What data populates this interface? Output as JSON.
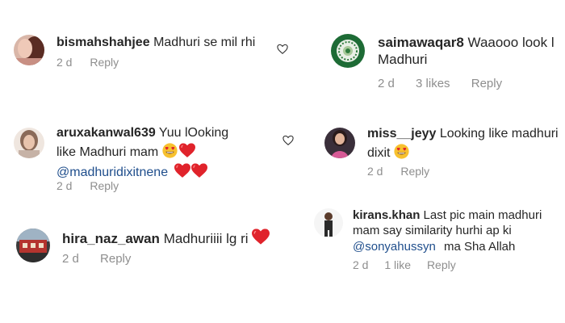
{
  "comments": [
    {
      "username": "bismahshahjee",
      "text": "Madhuri se mil rhi",
      "time": "2 d",
      "reply_label": "Reply"
    },
    {
      "username": "saimawaqar8",
      "text_line1": "Waaooo look l",
      "text_line2": "Madhuri",
      "time": "2 d",
      "likes": "3 likes",
      "reply_label": "Reply"
    },
    {
      "username": "aruxakanwal639",
      "text_line1": "Yuu lOoking",
      "text_line2": "like Madhuri mam",
      "mention": "@madhuridixitnene",
      "time": "2 d",
      "reply_label": "Reply"
    },
    {
      "username": "miss__jeyy",
      "text_line1": "Looking like madhuri",
      "text_line2": "dixit",
      "time": "2 d",
      "reply_label": "Reply"
    },
    {
      "username": "hira_naz_awan",
      "text": "Madhuriiii lg ri",
      "time": "2 d",
      "reply_label": "Reply"
    },
    {
      "username": "kirans.khan",
      "text_line1": "Last pic main madhuri",
      "text_line2": "mam say similarity hurhi ap ki",
      "mention": "@sonyahussyn",
      "text_line3": "ma Sha Allah",
      "time": "2 d",
      "likes": "1 like",
      "reply_label": "Reply"
    }
  ],
  "colors": {
    "meta": "#8e8e8e",
    "mention": "#1f4e8c",
    "heart": "#e0232b",
    "emoji_face": "#f7c12f"
  },
  "icons": {
    "like": "heart-outline-icon",
    "heart_emoji": "red-heart-emoji",
    "heart_eyes": "smiling-face-with-heart-eyes-emoji"
  }
}
